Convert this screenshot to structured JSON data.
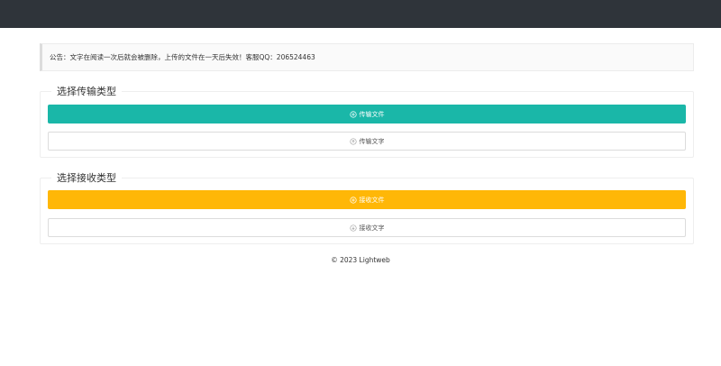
{
  "notice": {
    "text": "公告：文字在阅读一次后就会被删除，上传的文件在一天后失效！客服QQ：206524463"
  },
  "send_section": {
    "legend": "选择传输类型",
    "file_button": {
      "label": "传输文件",
      "icon": "plus-circle-icon",
      "color": "#1ab7a8"
    },
    "text_button": {
      "label": "传输文字",
      "icon": "upload-circle-icon"
    }
  },
  "receive_section": {
    "legend": "选择接收类型",
    "file_button": {
      "label": "接收文件",
      "icon": "plus-circle-icon",
      "color": "#ffb707"
    },
    "text_button": {
      "label": "接收文字",
      "icon": "download-circle-icon"
    }
  },
  "footer": {
    "text": "© 2023 Lightweb"
  },
  "colors": {
    "topbar": "#2f343a",
    "teal": "#1ab7a8",
    "gold": "#ffb707"
  }
}
